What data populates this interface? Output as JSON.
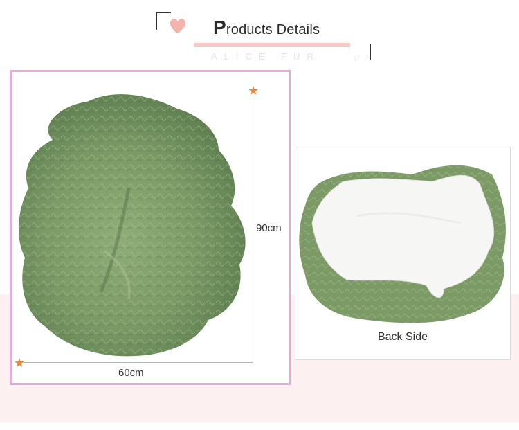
{
  "header": {
    "title_initial": "P",
    "title_rest": "roducts Details",
    "subtitle": "ALICE FUR"
  },
  "icons": {
    "heart": "heart-icon",
    "star": "star-icon"
  },
  "dimensions": {
    "height": "90cm",
    "width": "60cm"
  },
  "back_panel": {
    "label": "Back Side"
  },
  "colors": {
    "frame_pink": "#e7a9d8",
    "accent_bar": "#f4c9c6",
    "star_orange": "#e88a3a",
    "fur_green": "#7b9a66",
    "band_pink": "#fdf0f1"
  }
}
